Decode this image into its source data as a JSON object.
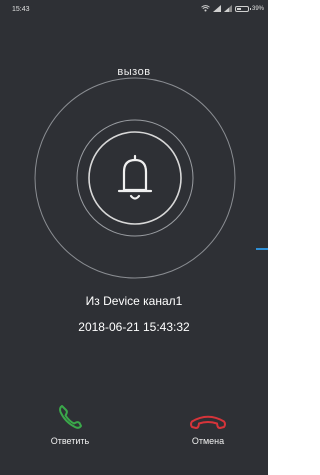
{
  "status_bar": {
    "time": "15:43",
    "battery_percent_label": "39%",
    "battery_level": 0.39
  },
  "call": {
    "title": "вызов",
    "caller": "Из Device канал1",
    "datetime": "2018-06-21  15:43:32"
  },
  "actions": {
    "answer_label": "Ответить",
    "cancel_label": "Отмена"
  },
  "colors": {
    "background": "#2e3035",
    "answer": "#3aa84a",
    "cancel": "#d6343a",
    "indicator": "#2f8fd6"
  },
  "icons": {
    "center": "bell-icon",
    "answer": "phone-icon",
    "cancel": "phone-hangup-icon"
  }
}
